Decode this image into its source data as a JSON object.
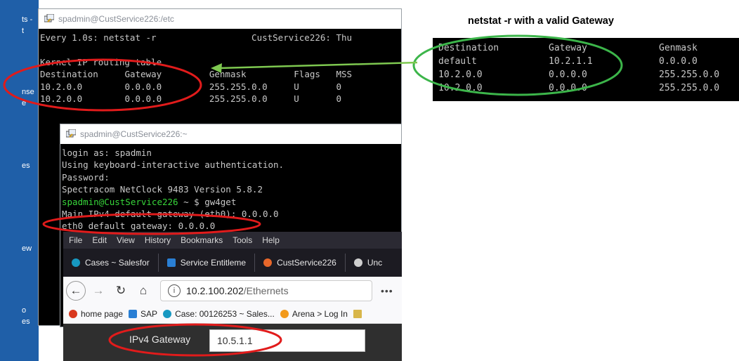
{
  "desktop": {
    "labels": [
      "ts -",
      "t",
      "nse",
      "e",
      "es",
      "ew",
      "o",
      "es"
    ]
  },
  "term1": {
    "title": "spadmin@CustService226:/etc",
    "header_left": "Every 1.0s: netstat -r",
    "header_right": "CustService226: Thu",
    "line_title": "Kernel IP routing table",
    "col_dest": "Destination",
    "col_gw": "Gateway",
    "col_mask": "Genmask",
    "col_flags": "Flags",
    "col_mss": "MSS",
    "rows": [
      {
        "dest": "10.2.0.0",
        "gw": "0.0.0.0",
        "mask": "255.255.0.0",
        "flags": "U",
        "mss": "0"
      },
      {
        "dest": "10.2.0.0",
        "gw": "0.0.0.0",
        "mask": "255.255.0.0",
        "flags": "U",
        "mss": "0"
      }
    ]
  },
  "term2": {
    "title": "spadmin@CustService226:~",
    "lines": [
      "login as: spadmin",
      "Using keyboard-interactive authentication.",
      "Password:",
      "Spectracom NetClock 9483 Version 5.8.2"
    ],
    "prompt": "spadmin@CustService226",
    "prompt_tail": " ~ $ gw4get",
    "line_main": "Main IPv4 default gateway (eth0): 0.0.0.0",
    "line_eth0": "eth0 default gateway: 0.0.0.0"
  },
  "browser": {
    "menu": [
      "File",
      "Edit",
      "View",
      "History",
      "Bookmarks",
      "Tools",
      "Help"
    ],
    "tabs": [
      {
        "label": "Cases ~ Salesfor",
        "color": "#1798c1"
      },
      {
        "label": "Service Entitleme",
        "color": "#2a7fd4"
      },
      {
        "label": "CustService226",
        "color": "#e8672a"
      },
      {
        "label": "Unc",
        "color": "#cfcfcf"
      }
    ],
    "url_host": "10.2.100.202",
    "url_path": "/Ethernets",
    "more": "•••",
    "bookmarks": [
      {
        "label": "home page",
        "color": "#d9381e"
      },
      {
        "label": "SAP",
        "color": "#2a7fd4"
      },
      {
        "label": "Case: 00126253 ~ Sales...",
        "color": "#1798c1"
      },
      {
        "label": "Arena > Log In",
        "color": "#f29a1c"
      }
    ],
    "gw_label": "IPv4 Gateway",
    "gw_value": "10.5.1.1"
  },
  "right": {
    "heading": "netstat -r with a valid Gateway",
    "col_dest": "Destination",
    "col_gw": "Gateway",
    "col_mask": "Genmask",
    "rows": [
      {
        "dest": "default",
        "gw": "10.2.1.1",
        "mask": "0.0.0.0"
      },
      {
        "dest": "10.2.0.0",
        "gw": "0.0.0.0",
        "mask": "255.255.0.0"
      },
      {
        "dest": "10.2.0.0",
        "gw": "0.0.0.0",
        "mask": "255.255.0.0"
      }
    ]
  },
  "colors": {
    "annotation_red": "#e11b1b",
    "annotation_green": "#3cb54a",
    "terminal_bg": "#000000",
    "terminal_text": "#c8c8c8",
    "prompt_green": "#37d63a"
  }
}
